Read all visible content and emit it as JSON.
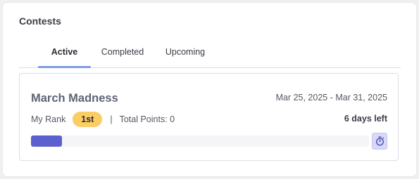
{
  "panel": {
    "title": "Contests"
  },
  "tabs": [
    {
      "label": "Active",
      "active": true
    },
    {
      "label": "Completed",
      "active": false
    },
    {
      "label": "Upcoming",
      "active": false
    }
  ],
  "contest": {
    "name": "March Madness",
    "dates": "Mar 25, 2025 - Mar 31, 2025",
    "rank_label": "My Rank",
    "rank_value": "1st",
    "separator": "|",
    "points_text": "Total Points: 0",
    "time_left": "6 days left",
    "progress_fraction": 0.092,
    "timer_icon": "stopwatch-icon"
  },
  "colors": {
    "accent_tab": "#7f9ce6",
    "progress": "#5b5fd0",
    "rank_badge": "#fbcd63",
    "timer_button": "#d8d9f5"
  }
}
